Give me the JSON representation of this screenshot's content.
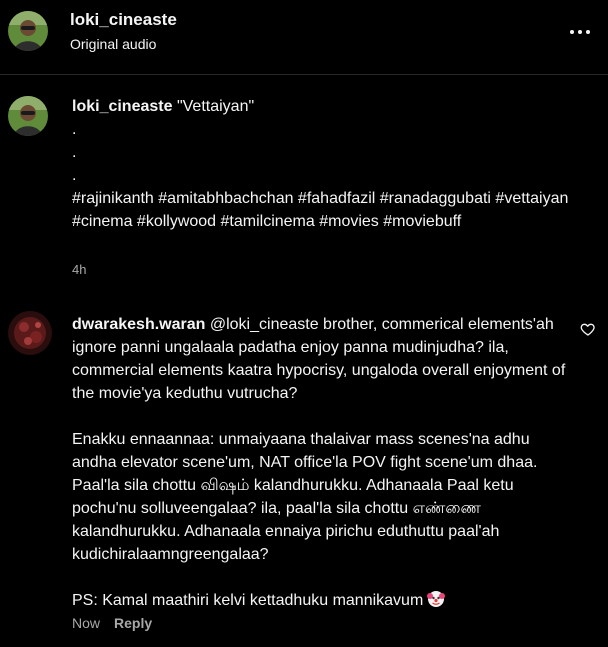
{
  "header": {
    "username": "loki_cineaste",
    "subtitle": "Original audio",
    "more_icon": "more-horizontal-icon"
  },
  "caption": {
    "username": "loki_cineaste",
    "text": "\"Vettaiyan\"\n.\n.\n.\n#rajinikanth #amitabhbachchan #fahadfazil #ranadaggubati #vettaiyan #cinema #kollywood #tamilcinema #movies #moviebuff",
    "time": "4h"
  },
  "comment": {
    "username": "dwarakesh.waran",
    "text": "@loki_cineaste brother, commerical elements'ah ignore panni ungalaala padatha enjoy panna mudinjudha? ila, commercial elements kaatra hypocrisy, ungaloda overall enjoyment of the movie'ya keduthu vutrucha?\n\nEnakku ennaannaa: unmaiyaana thalaivar mass scenes'na adhu andha elevator scene'um, NAT office'la POV fight scene'um dhaa. Paal'la sila chottu விஷம் kalandhurukku. Adhanaala Paal ketu pochu'nu solluveengalaa? ila, paal'la sila chottu எண்ணை kalandhurukku. Adhanaala ennaiya pirichu eduthuttu paal'ah kudichiralaamngreengalaa?\n\nPS: Kamal maathiri kelvi kettadhuku mannikavum",
    "emoji_icon": "clown-face-icon",
    "time": "Now",
    "reply_label": "Reply",
    "like_icon": "heart-outline-icon"
  },
  "colors": {
    "background": "#000000",
    "text_primary": "#f5f5f5",
    "text_secondary": "#a8a8a8",
    "divider": "#262626"
  }
}
